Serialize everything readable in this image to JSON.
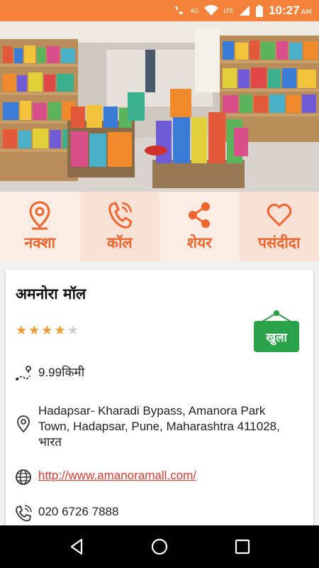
{
  "status_bar": {
    "network_label": "4G",
    "lte_label": "LTE",
    "time": "10:27",
    "ampm": "AM"
  },
  "hero": {
    "icon": "store-photo"
  },
  "actions": [
    {
      "label": "नक्शा",
      "icon": "map-pin-icon"
    },
    {
      "label": "कॉल",
      "icon": "phone-icon"
    },
    {
      "label": "शेयर",
      "icon": "share-icon"
    },
    {
      "label": "पसंदीदा",
      "icon": "heart-icon"
    }
  ],
  "place": {
    "name": "अमनोरा मॉल",
    "rating": 4,
    "rating_max": 5,
    "open_label": "खुला",
    "distance": "9.99किमी",
    "address_line1": "Hadapsar- Kharadi Bypass, Amanora Park",
    "address_line2": "Town, Hadapsar, Pune, Maharashtra 411028,",
    "address_line3": "भारत",
    "website": "http://www.amanoramall.com/",
    "phone": "020 6726 7888"
  },
  "colors": {
    "accent": "#f0642d",
    "status_bar": "#f5823a",
    "open_green": "#2aa24a",
    "star": "#f59a2e",
    "link": "#e23b2e"
  }
}
